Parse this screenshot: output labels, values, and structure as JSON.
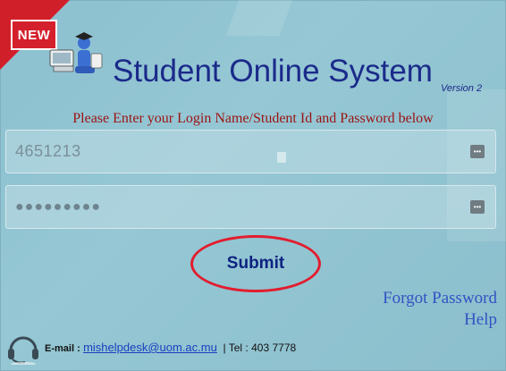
{
  "badge": {
    "label": "NEW"
  },
  "header": {
    "title": "Student Online System",
    "version": "Version 2"
  },
  "form": {
    "instruction": "Please Enter your Login Name/Student Id and Password below",
    "username_value": "4651213",
    "password_mask": "●●●●●●●●●",
    "submit_label": "Submit"
  },
  "links": {
    "forgot": "Forgot Password",
    "help": "Help"
  },
  "contact": {
    "email_label": "E-mail :",
    "email": "mishelpdesk@uom.ac.mu",
    "tel_label": "| Tel :",
    "tel": "403 7778"
  },
  "icons": {
    "mascot": "graduate-computer-icon",
    "key": "password-key-icon",
    "headset": "headset-icon"
  },
  "colors": {
    "title": "#1b2a8a",
    "instruction": "#9b1313",
    "link": "#3153c4",
    "submit_ring": "#e21d2e",
    "badge": "#d4202c"
  }
}
